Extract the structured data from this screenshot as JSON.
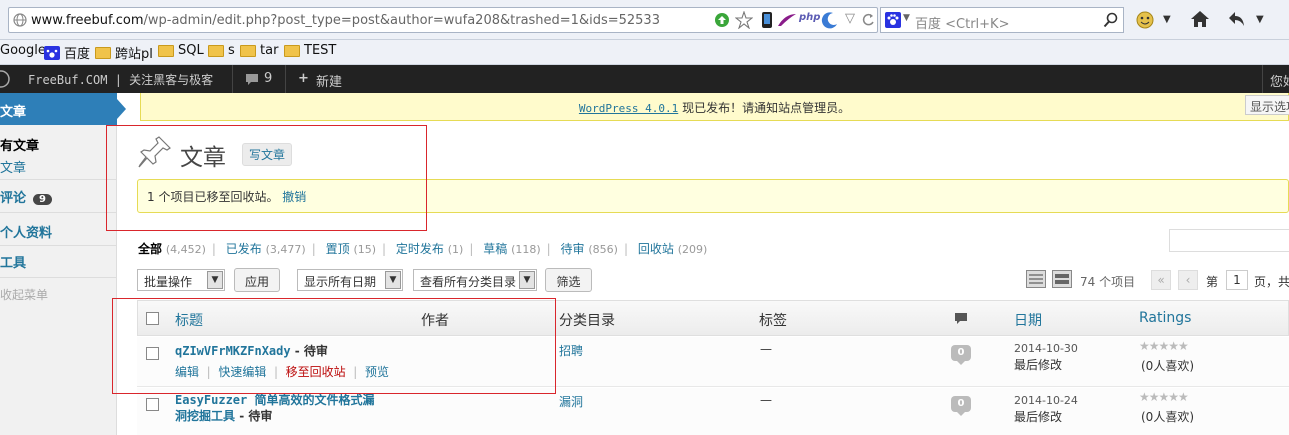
{
  "browser": {
    "url_host": "www.freebuf.com",
    "url_path": "/wp-admin/edit.php?post_type=post&author=wufa208&trashed=1&ids=52533",
    "search_placeholder": "百度 <Ctrl+K>",
    "icons": [
      "go-icon",
      "star-icon",
      "mobile-icon",
      "feather-icon",
      "php-icon",
      "crescent-icon",
      "dropdown-icon",
      "baidu-icon",
      "search-icon",
      "extension-icon",
      "home-icon",
      "back-icon"
    ]
  },
  "bookmarks": [
    {
      "label": "Google"
    },
    {
      "label": "百度"
    },
    {
      "label": "跨站pl"
    },
    {
      "label": "SQL"
    },
    {
      "label": "s"
    },
    {
      "label": "tar"
    },
    {
      "label": "TEST"
    }
  ],
  "adminbar": {
    "site": "FreeBuf.COM | 关注黑客与极客",
    "comments": "9",
    "new": "新建",
    "right": "您好"
  },
  "sidebar": {
    "posts_head": "文章",
    "all_posts": "有文章",
    "sub_posts": "文章",
    "comments": "评论",
    "comments_badge": "9",
    "profile": "个人资料",
    "tools": "工具",
    "collapse": "收起菜单"
  },
  "notice": {
    "link": "WordPress 4.0.1",
    "text": " 现已发布！请通知站点管理员。"
  },
  "screen_options": "显示选项",
  "page": {
    "title": "文章",
    "add_new": "写文章",
    "message": "1 个项目已移至回收站。",
    "undo": "撤销"
  },
  "filters": [
    {
      "label": "全部",
      "count": "(4,452)"
    },
    {
      "label": "已发布",
      "count": "(3,477)"
    },
    {
      "label": "置顶",
      "count": "(15)"
    },
    {
      "label": "定时发布",
      "count": "(1)"
    },
    {
      "label": "草稿",
      "count": "(118)"
    },
    {
      "label": "待审",
      "count": "(856)"
    },
    {
      "label": "回收站",
      "count": "(209)"
    }
  ],
  "toolbar": {
    "bulk": "批量操作",
    "apply": "应用",
    "dates": "显示所有日期",
    "cats": "查看所有分类目录",
    "filter": "筛选",
    "items": "74 个项目",
    "first": "«",
    "prev": "‹",
    "page_prefix": "第",
    "page_num": "1",
    "page_suffix": "页，共"
  },
  "table": {
    "headers": {
      "title": "标题",
      "author": "作者",
      "categories": "分类目录",
      "tags": "标签",
      "date": "日期",
      "ratings": "Ratings"
    },
    "rows": [
      {
        "title": "qZIwVFrMKZFnXady",
        "status": " - 待审",
        "edit": "编辑",
        "quick": "快速编辑",
        "trash": "移至回收站",
        "preview": "预览",
        "category": "招聘",
        "tags": "—",
        "comments": "0",
        "date": "2014-10-30",
        "modified": "最后修改",
        "likes": "(0人喜欢)"
      },
      {
        "title_line1": "EasyFuzzer 简单高效的文件格式漏",
        "title_line2": "洞挖掘工具",
        "status": " - 待审",
        "category": "漏洞",
        "tags": "—",
        "comments": "0",
        "date": "2014-10-24",
        "modified": "最后修改",
        "likes": "(0人喜欢)"
      }
    ]
  }
}
